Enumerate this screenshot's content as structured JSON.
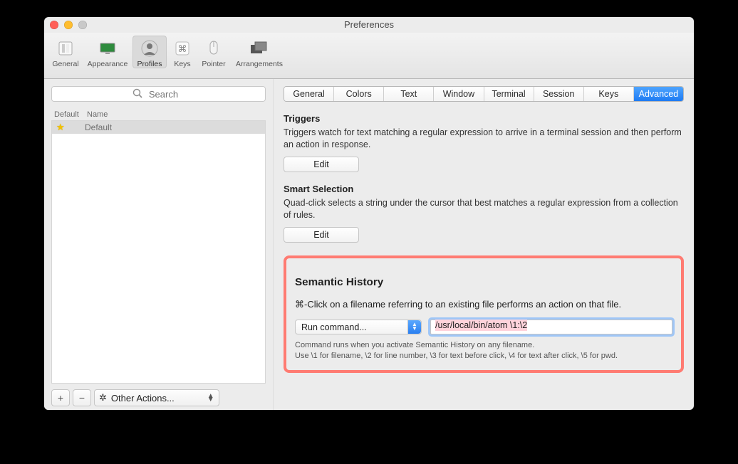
{
  "window": {
    "title": "Preferences"
  },
  "toolbar": {
    "items": [
      {
        "label": "General"
      },
      {
        "label": "Appearance"
      },
      {
        "label": "Profiles"
      },
      {
        "label": "Keys"
      },
      {
        "label": "Pointer"
      },
      {
        "label": "Arrangements"
      }
    ],
    "selected_index": 2
  },
  "sidebar": {
    "search_placeholder": "Search",
    "columns": {
      "default": "Default",
      "name": "Name"
    },
    "profiles": [
      {
        "name": "Default",
        "is_default": true,
        "selected": true
      }
    ],
    "add_label": "+",
    "remove_label": "−",
    "other_actions_label": "Other Actions..."
  },
  "tabs": {
    "items": [
      "General",
      "Colors",
      "Text",
      "Window",
      "Terminal",
      "Session",
      "Keys",
      "Advanced"
    ],
    "active_index": 7
  },
  "triggers": {
    "title": "Triggers",
    "desc": "Triggers watch for text matching a regular expression to arrive in a terminal session and then perform an action in response.",
    "edit": "Edit"
  },
  "smart": {
    "title": "Smart Selection",
    "desc": "Quad-click selects a string under the cursor that best matches a regular expression from a collection of rules.",
    "edit": "Edit"
  },
  "semantic": {
    "title": "Semantic History",
    "desc": "⌘-Click on a filename referring to an existing file performs an action on that file.",
    "select_value": "Run command...",
    "input_value": "/usr/local/bin/atom \\1:\\2",
    "hint1": "Command runs when you activate Semantic History on any filename.",
    "hint2": "Use \\1 for filename, \\2 for line number, \\3 for text before click, \\4 for text after click, \\5 for pwd."
  }
}
